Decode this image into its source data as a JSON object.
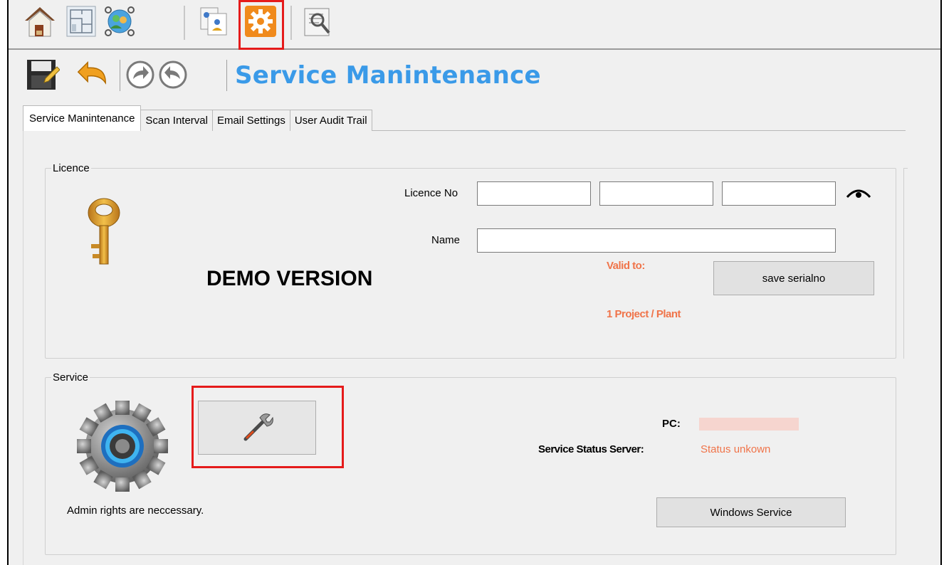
{
  "ribbon": {
    "buttons": [
      {
        "icon": "home-icon"
      },
      {
        "icon": "floor-plan-icon"
      },
      {
        "icon": "network-users-icon"
      },
      {
        "icon": "user-documents-icon"
      },
      {
        "icon": "settings-gear-icon"
      },
      {
        "icon": "report-edit-icon"
      }
    ],
    "highlight_color": "#e51b1b"
  },
  "toolbar": {
    "buttons": [
      {
        "icon": "save-icon"
      },
      {
        "icon": "undo-icon"
      },
      {
        "icon": "forward-icon"
      },
      {
        "icon": "back-icon"
      }
    ],
    "title": "Service Manintenance",
    "title_color": "#3a9ae8"
  },
  "tabs": [
    {
      "label": "Service Manintenance",
      "active": true
    },
    {
      "label": "Scan Interval",
      "active": false
    },
    {
      "label": "Email Settings",
      "active": false
    },
    {
      "label": "User Audit Trail",
      "active": false
    }
  ],
  "licence": {
    "group_title": "Licence",
    "licence_no_label": "Licence No",
    "licence_no_parts": [
      "",
      "",
      ""
    ],
    "name_label": "Name",
    "name_value": "",
    "demo_text": "DEMO VERSION",
    "valid_to_label": "Valid to:",
    "plan_text": "1 Project / Plant",
    "save_button_label": "save serialno",
    "accent_color": "#f0744a"
  },
  "service": {
    "group_title": "Service",
    "admin_note": "Admin rights are neccessary.",
    "pc_label": "PC:",
    "pc_value": "",
    "status_label": "Service Status Server:",
    "status_value": "Status unkown",
    "windows_service_button_label": "Windows Service"
  }
}
